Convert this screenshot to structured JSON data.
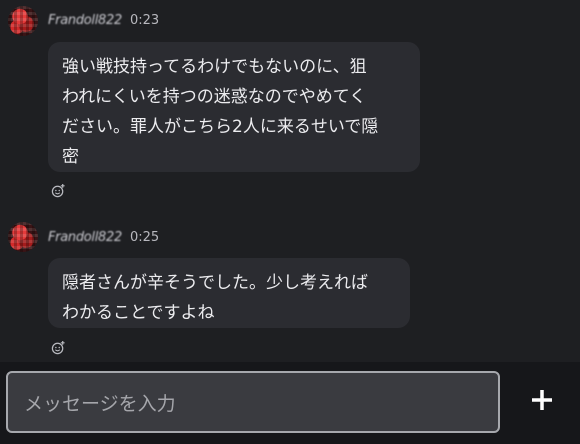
{
  "messages": [
    {
      "username": "Frandoll822",
      "time": "0:23",
      "text": "強い戦技持ってるわけでもないのに、狙\nわれにくいを持つの迷惑なのでやめてく\nださい。罪人がこちら2人に来るせいで隠\n密"
    },
    {
      "username": "Frandoll822",
      "time": "0:25",
      "text": "隠者さんが辛そうでした。少し考えれば\nわかることですよね"
    }
  ],
  "composer": {
    "placeholder": "メッセージを入力",
    "add_icon": "plus-icon"
  },
  "icons": {
    "reaction": "add-reaction-icon"
  },
  "colors": {
    "background": "#1e1f22",
    "bubble": "#2b2c31",
    "input_border": "#a6a8ad"
  }
}
